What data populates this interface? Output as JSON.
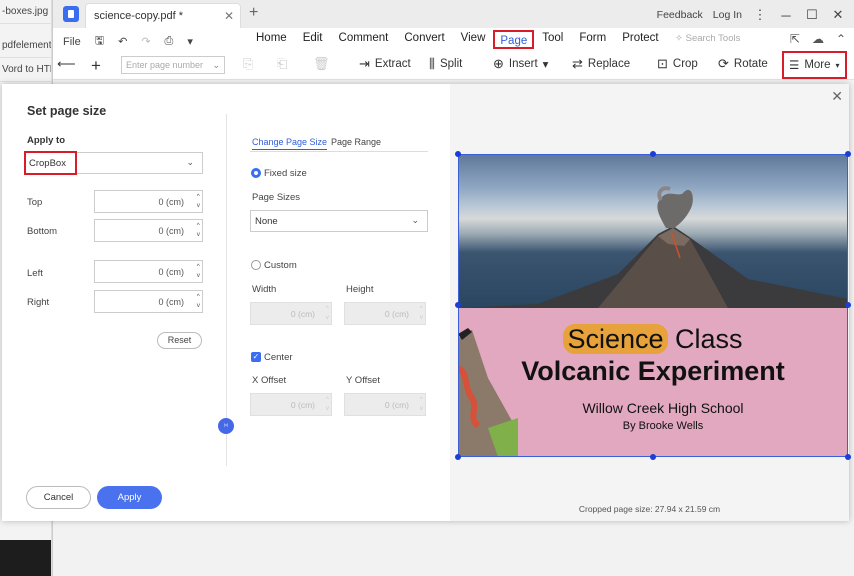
{
  "background_app": {
    "items": [
      "-boxes.jpg (E",
      "pdfelement",
      "Vord to HTM"
    ]
  },
  "window": {
    "tab_title": "science-copy.pdf *",
    "feedback": "Feedback",
    "login": "Log In"
  },
  "menu": {
    "file": "File",
    "items": [
      "Home",
      "Edit",
      "Comment",
      "Convert",
      "View",
      "Page",
      "Tool",
      "Form",
      "Protect"
    ],
    "active": "Page",
    "search_placeholder": "Search Tools"
  },
  "toolbar": {
    "page_number_placeholder": "Enter page number",
    "extract": "Extract",
    "split": "Split",
    "insert": "Insert",
    "replace": "Replace",
    "crop": "Crop",
    "rotate": "Rotate",
    "more": "More"
  },
  "dialog": {
    "title": "Set page size",
    "apply_to_label": "Apply to",
    "apply_to_value": "CropBox",
    "margins": {
      "top_label": "Top",
      "top_value": "0 (cm)",
      "bottom_label": "Bottom",
      "bottom_value": "0 (cm)",
      "left_label": "Left",
      "left_value": "0 (cm)",
      "right_label": "Right",
      "right_value": "0 (cm)"
    },
    "reset": "Reset",
    "tabs": [
      "Change Page Size",
      "Page Range"
    ],
    "fixed_size_label": "Fixed size",
    "page_sizes_label": "Page Sizes",
    "page_sizes_value": "None",
    "custom_label": "Custom",
    "width_label": "Width",
    "width_value": "0 (cm)",
    "height_label": "Height",
    "height_value": "0 (cm)",
    "center_label": "Center",
    "x_offset_label": "X Offset",
    "x_offset_value": "0 (cm)",
    "y_offset_label": "Y Offset",
    "y_offset_value": "0 (cm)",
    "cancel": "Cancel",
    "apply": "Apply",
    "cropped_size": "Cropped page size: 27.94 x 21.59 cm"
  },
  "preview": {
    "title_highlight": "Science",
    "title_rest": "Class",
    "subtitle": "Volcanic Experiment",
    "school": "Willow Creek High School",
    "author": "By Brooke Wells"
  },
  "colors": {
    "accent": "#3a6df0",
    "highlight_red": "#d91c2a",
    "slide_pink": "#e2a8bf",
    "title_orange": "#e8a23c"
  }
}
